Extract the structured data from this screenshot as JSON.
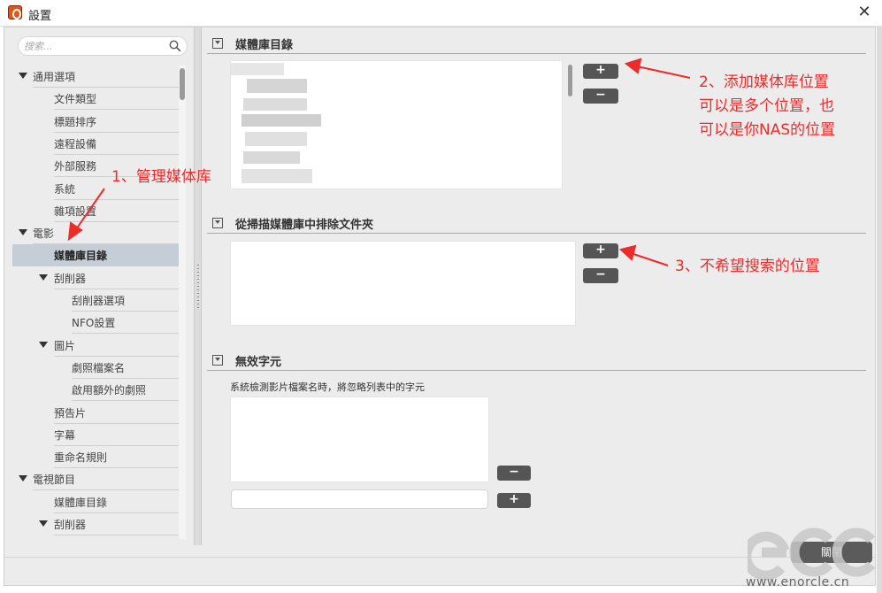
{
  "window": {
    "title": "設置",
    "close_glyph": "✕"
  },
  "sidebar": {
    "search_placeholder": "搜索...",
    "items": [
      {
        "label": "通用選項",
        "level": 0,
        "expanded": true
      },
      {
        "label": "文件類型",
        "level": 1
      },
      {
        "label": "標題排序",
        "level": 1
      },
      {
        "label": "遠程設備",
        "level": 1
      },
      {
        "label": "外部服務",
        "level": 1
      },
      {
        "label": "系統",
        "level": 1
      },
      {
        "label": "雜項設置",
        "level": 1
      },
      {
        "label": "電影",
        "level": 0,
        "expanded": true
      },
      {
        "label": "媒體庫目錄",
        "level": 1,
        "selected": true
      },
      {
        "label": "刮削器",
        "level": 1,
        "expanded": true
      },
      {
        "label": "刮削器選項",
        "level": 2
      },
      {
        "label": "NFO設置",
        "level": 2
      },
      {
        "label": "圖片",
        "level": 1,
        "expanded": true
      },
      {
        "label": "劇照檔案名",
        "level": 2
      },
      {
        "label": "啟用額外的劇照",
        "level": 2
      },
      {
        "label": "預告片",
        "level": 1
      },
      {
        "label": "字幕",
        "level": 1
      },
      {
        "label": "重命名規則",
        "level": 1
      },
      {
        "label": "電視節目",
        "level": 0,
        "expanded": true
      },
      {
        "label": "媒體庫目錄",
        "level": 1
      },
      {
        "label": "刮削器",
        "level": 1,
        "expanded": true
      }
    ]
  },
  "sections": {
    "media_dirs": {
      "title": "媒體庫目錄",
      "add": "+",
      "remove": "−"
    },
    "exclude_dirs": {
      "title": "從掃描媒體庫中排除文件夾",
      "add": "+",
      "remove": "−"
    },
    "bad_words": {
      "title": "無效字元",
      "hint": "系統檢測影片檔案名時，將忽略列表中的字元",
      "add": "+",
      "remove": "−"
    }
  },
  "footer": {
    "close_label": "關閉"
  },
  "annotations": {
    "a1": "1、管理媒体库",
    "a2_line1": "2、添加媒体库位置",
    "a2_line2": "可以是多个位置，也",
    "a2_line3": "可以是你NAS的位置",
    "a3": "3、不希望搜索的位置",
    "color": "#ee2b2b"
  },
  "watermark": {
    "logo": "ECC",
    "url": "www.enorcle.cn"
  }
}
